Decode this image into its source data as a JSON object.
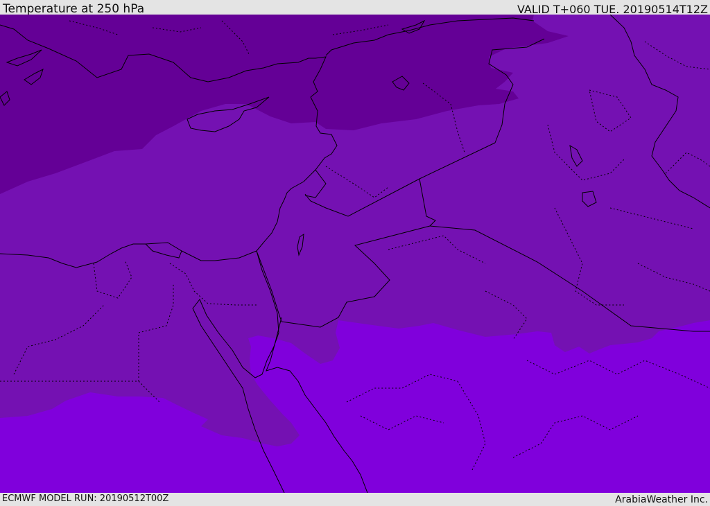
{
  "header": {
    "title": "Temperature at 250 hPa",
    "valid_time": "VALID T+060 TUE. 20190514T12Z"
  },
  "footer": {
    "model_run": "ECMWF MODEL RUN: 20190512T00Z",
    "credit": "ArabiaWeather Inc."
  },
  "map": {
    "colors": {
      "cold_band": "#640096",
      "mid_band": "#7411b2",
      "warm_band": "#8000dc",
      "coastline": "#000000"
    }
  }
}
